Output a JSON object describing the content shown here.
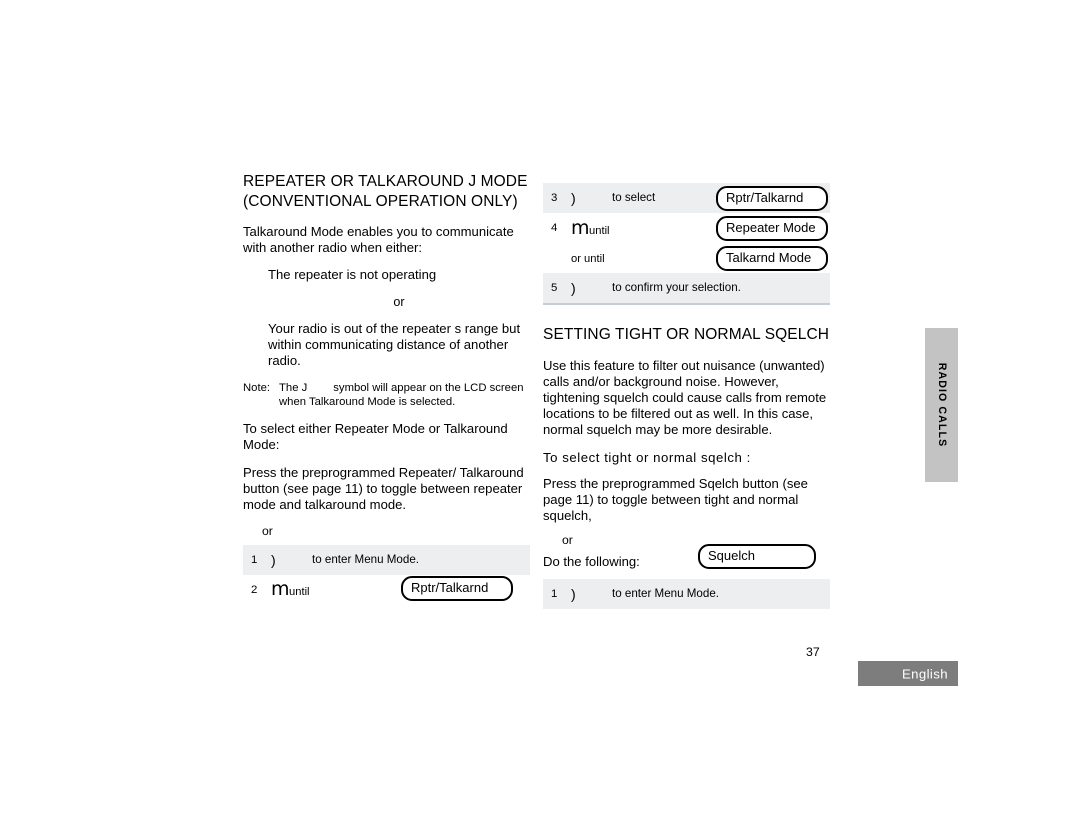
{
  "page": {
    "number": "37",
    "language_label": "English",
    "side_tab": "RADIO CALLS"
  },
  "left_column": {
    "title": "REPEATER OR TALKAROUND J MODE (CONVENTIONAL OPERATION ONLY)",
    "intro": "Talkaround Mode enables you to communicate with another radio when either:",
    "bullet_1": "The repeater is not operating",
    "or_divider": "or",
    "bullet_2": "Your radio is out of the repeater s range but within communicating distance of another radio.",
    "note": {
      "label": "Note:",
      "line_1_before": "The J",
      "line_1_after": "symbol will appear on the LCD screen",
      "line_2": "when Talkaround Mode is selected."
    },
    "lead_in": "To select either Repeater Mode or Talkaround Mode:",
    "instruction": "Press the preprogrammed Repeater/ Talkaround button (see page 11) to toggle between repeater mode and talkaround mode.",
    "or_label": "or",
    "steps": [
      {
        "num": "1",
        "key": ")",
        "text": "to enter Menu Mode.",
        "shaded": true
      },
      {
        "num": "2",
        "key": "m",
        "key_suffix": "until",
        "text": "",
        "shaded": false
      }
    ],
    "lcd_label": "Rptr/Talkarnd"
  },
  "right_column": {
    "steps": [
      {
        "num": "3",
        "key": ")",
        "text": "to select",
        "lcd": "Rptr/Talkarnd",
        "shaded": true
      },
      {
        "num": "4",
        "key": "m",
        "key_suffix": "until",
        "text": "",
        "lcd": "Repeater Mode",
        "shaded": false
      },
      {
        "num": "",
        "key": "",
        "key_suffix": "or until",
        "text": "",
        "lcd": "Talkarnd Mode",
        "shaded": false
      },
      {
        "num": "5",
        "key": ")",
        "text": "to confirm your selection.",
        "lcd": "",
        "shaded": true
      }
    ],
    "title": "SETTING TIGHT OR NORMAL SQELCH",
    "body": "Use this feature to filter out nuisance (unwanted) calls and/or background noise. However, tightening squelch could cause calls from remote locations to be filtered out as well. In this case, normal squelch may be more desirable.",
    "subheading": "To select tight or normal sqelch  :",
    "instruction": "Press the preprogrammed Sqelch   button (see page 11) to toggle between tight and normal squelch,",
    "or_label": "or",
    "do_following": "Do the following:",
    "lcd_label": "Squelch",
    "steps_bottom": [
      {
        "num": "1",
        "key": ")",
        "text": "to enter Menu Mode.",
        "shaded": true
      }
    ]
  }
}
